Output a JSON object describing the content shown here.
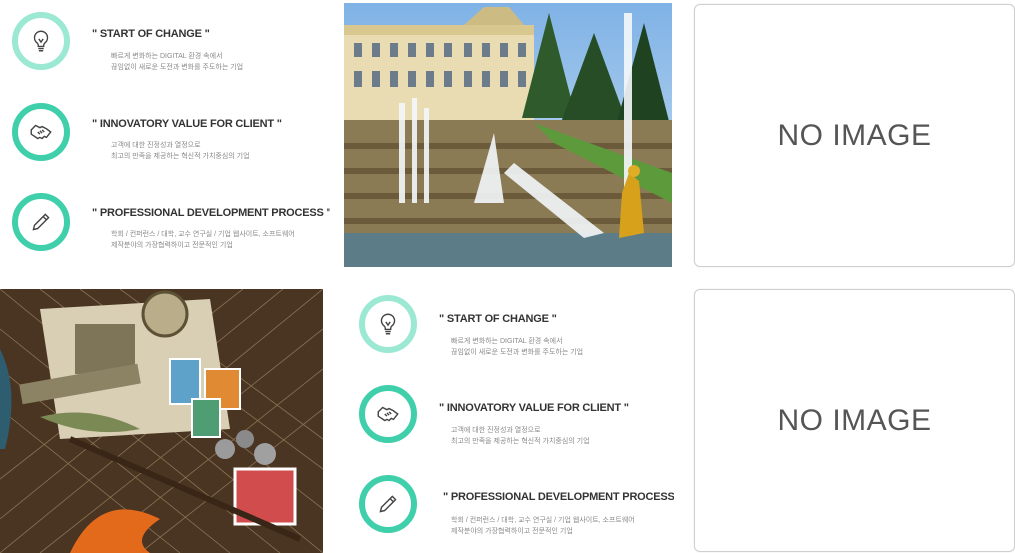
{
  "features_panel": {
    "items": [
      {
        "title": "\" START OF CHANGE \"",
        "desc_line1": "빠르게 변화하는 DIGITAL 환경 속에서",
        "desc_line2": "끊임없이 새로운 도전과 변화를 주도하는 기업",
        "icon": "lightbulb-icon"
      },
      {
        "title": "\" INNOVATORY VALUE FOR CLIENT \"",
        "desc_line1": "고객에 대한 진정성과 열정으로",
        "desc_line2": "최고의 만족을 제공하는 혁신적 가치중심의 기업",
        "icon": "handshake-icon"
      },
      {
        "title": "\" PROFESSIONAL DEVELOPMENT PROCESS \"",
        "desc_line1": "학회 / 컨퍼런스 / 대학, 교수 연구실 / 기업 웹사이트, 소프트웨어",
        "desc_line2": "제작분야의 가장협력하이고 전문적인 기업",
        "icon": "pencil-icon"
      }
    ]
  },
  "placeholder": {
    "text": "NO IMAGE"
  },
  "photos": {
    "palace": "palace-fountain-photo",
    "still_life": "fishing-still-life-photo"
  },
  "colors": {
    "ring_light": "#9be8d3",
    "ring_dark": "#3fcfaa",
    "icon": "#444444"
  }
}
